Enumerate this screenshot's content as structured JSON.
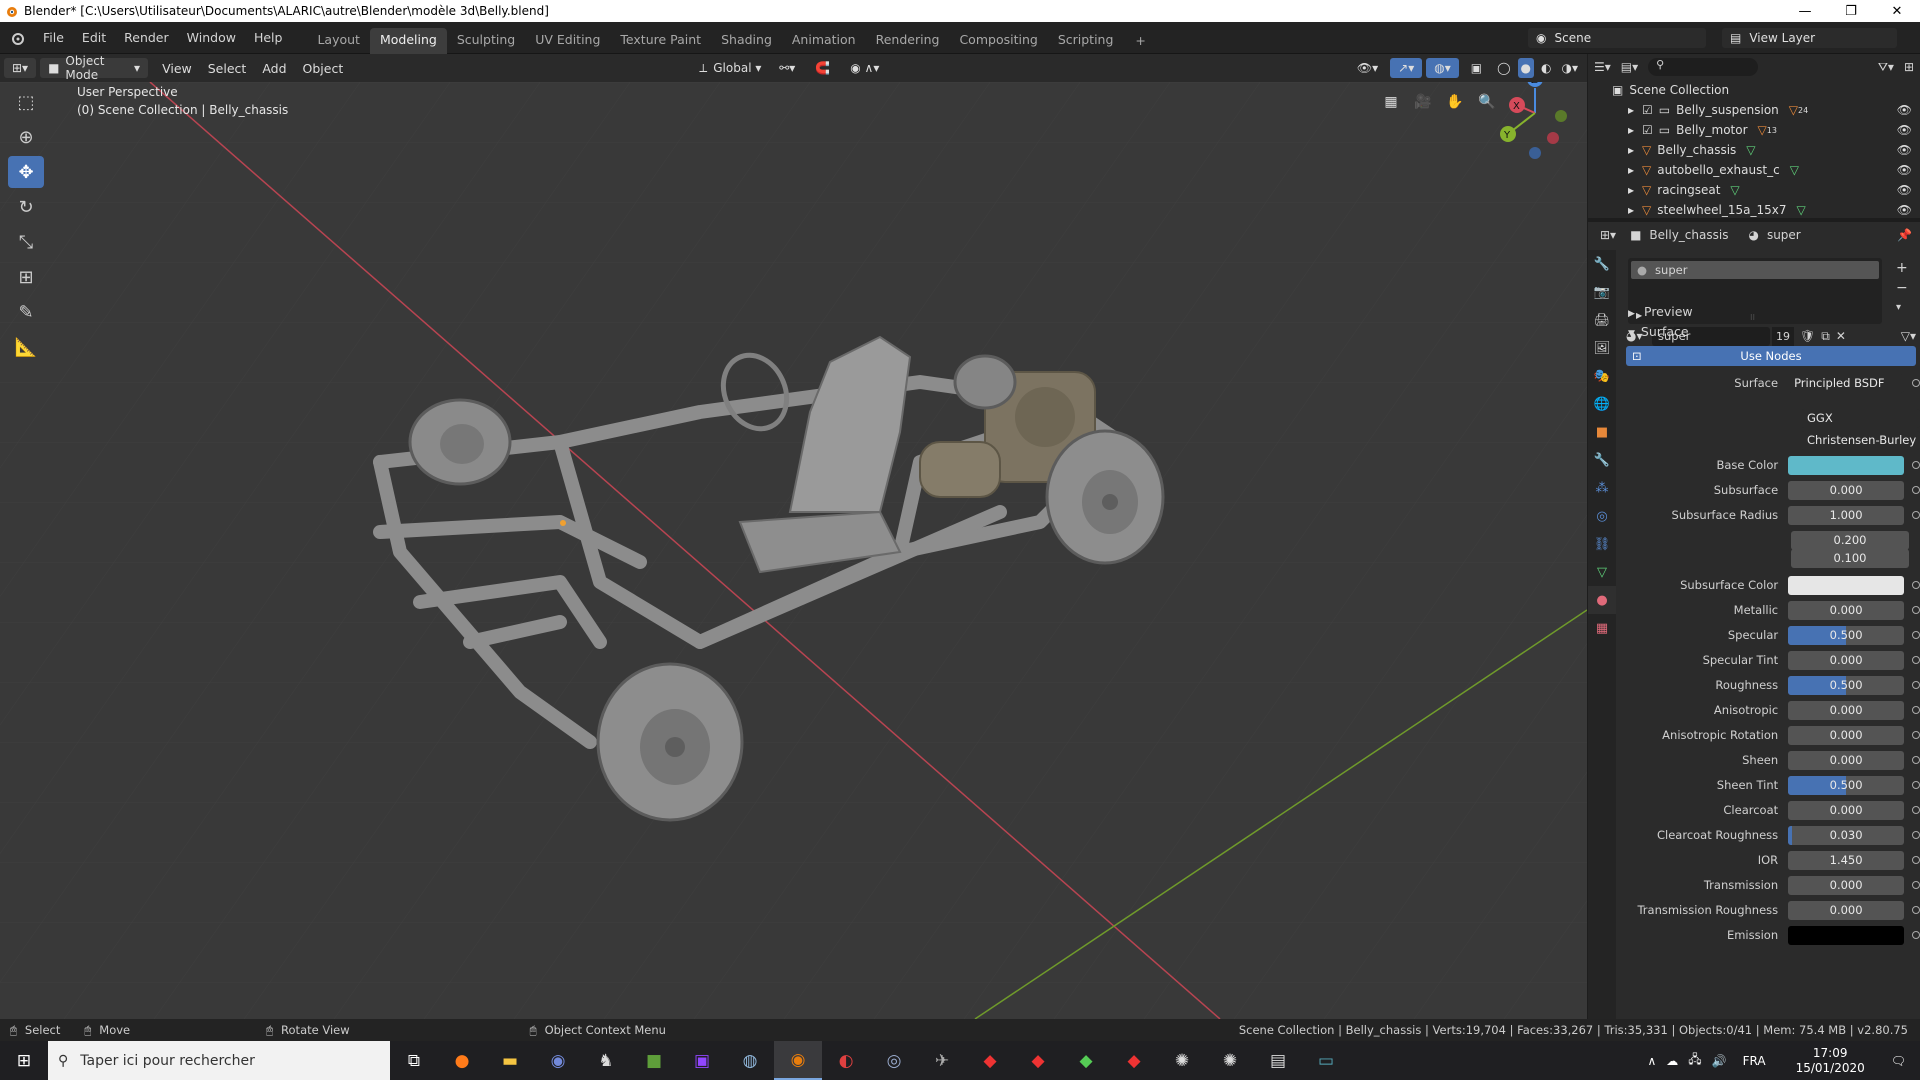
{
  "window": {
    "title": "Blender* [C:\\Users\\Utilisateur\\Documents\\ALARIC\\autre\\Blender\\modèle 3d\\Belly.blend]",
    "minimize": "—",
    "maximize": "❐",
    "close": "✕"
  },
  "menu": [
    "File",
    "Edit",
    "Render",
    "Window",
    "Help"
  ],
  "workspaces": [
    "Layout",
    "Modeling",
    "Sculpting",
    "UV Editing",
    "Texture Paint",
    "Shading",
    "Animation",
    "Rendering",
    "Compositing",
    "Scripting"
  ],
  "active_workspace": "Modeling",
  "scene": "Scene",
  "view_layer": "View Layer",
  "viewport_header": {
    "mode": "Object Mode",
    "menus": [
      "View",
      "Select",
      "Add",
      "Object"
    ],
    "orientation": "Global"
  },
  "viewport": {
    "perspective": "User Perspective",
    "collection": "(0) Scene Collection | Belly_chassis"
  },
  "gizmo": {
    "x": "X",
    "y": "Y",
    "z": "Z"
  },
  "outliner": {
    "root": "Scene Collection",
    "items": [
      {
        "name": "Belly_suspension",
        "type": "collection",
        "badge": "24"
      },
      {
        "name": "Belly_motor",
        "type": "collection",
        "badge": "13"
      },
      {
        "name": "Belly_chassis",
        "type": "mesh",
        "badge": ""
      },
      {
        "name": "autobello_exhaust_c",
        "type": "mesh",
        "badge": ""
      },
      {
        "name": "racingseat",
        "type": "mesh",
        "badge": ""
      },
      {
        "name": "steelwheel_15a_15x7",
        "type": "mesh",
        "badge": ""
      }
    ]
  },
  "properties": {
    "object": "Belly_chassis",
    "material": "super",
    "slot": "super",
    "users": "19",
    "preview": "Preview",
    "surface_section": "Surface",
    "use_nodes": "Use Nodes",
    "surface_label": "Surface",
    "surface_shader": "Principled BSDF",
    "distribution": "GGX",
    "subsurface_method": "Christensen-Burley",
    "base_color_label": "Base Color",
    "base_color": "#5fb9c9",
    "subsurface_color_label": "Subsurface Color",
    "subsurface_color": "#e6e6e6",
    "subsurface_radius_label": "Subsurface Radius",
    "subsurface_radius": [
      "1.000",
      "0.200",
      "0.100"
    ],
    "fields": [
      {
        "label": "Subsurface",
        "value": "0.000",
        "fill": 0
      },
      {
        "label": "Metallic",
        "value": "0.000",
        "fill": 0
      },
      {
        "label": "Specular",
        "value": "0.500",
        "fill": 0.5
      },
      {
        "label": "Specular Tint",
        "value": "0.000",
        "fill": 0
      },
      {
        "label": "Roughness",
        "value": "0.500",
        "fill": 0.5
      },
      {
        "label": "Anisotropic",
        "value": "0.000",
        "fill": 0
      },
      {
        "label": "Anisotropic Rotation",
        "value": "0.000",
        "fill": 0
      },
      {
        "label": "Sheen",
        "value": "0.000",
        "fill": 0
      },
      {
        "label": "Sheen Tint",
        "value": "0.500",
        "fill": 0.5
      },
      {
        "label": "Clearcoat",
        "value": "0.000",
        "fill": 0
      },
      {
        "label": "Clearcoat Roughness",
        "value": "0.030",
        "fill": 0.03
      },
      {
        "label": "IOR",
        "value": "1.450",
        "fill": 0
      },
      {
        "label": "Transmission",
        "value": "0.000",
        "fill": 0
      },
      {
        "label": "Transmission Roughness",
        "value": "0.000",
        "fill": 0
      },
      {
        "label": "Emission",
        "value": "",
        "fill": 0
      }
    ]
  },
  "statusbar": {
    "select": "Select",
    "move": "Move",
    "rotate": "Rotate View",
    "context": "Object Context Menu",
    "stats": "Scene Collection | Belly_chassis | Verts:19,704 | Faces:33,267 | Tris:35,331 | Objects:0/41 | Mem: 75.4 MB | v2.80.75"
  },
  "taskbar": {
    "search_placeholder": "Taper ici pour rechercher",
    "lang": "FRA",
    "time": "17:09",
    "date": "15/01/2020"
  }
}
